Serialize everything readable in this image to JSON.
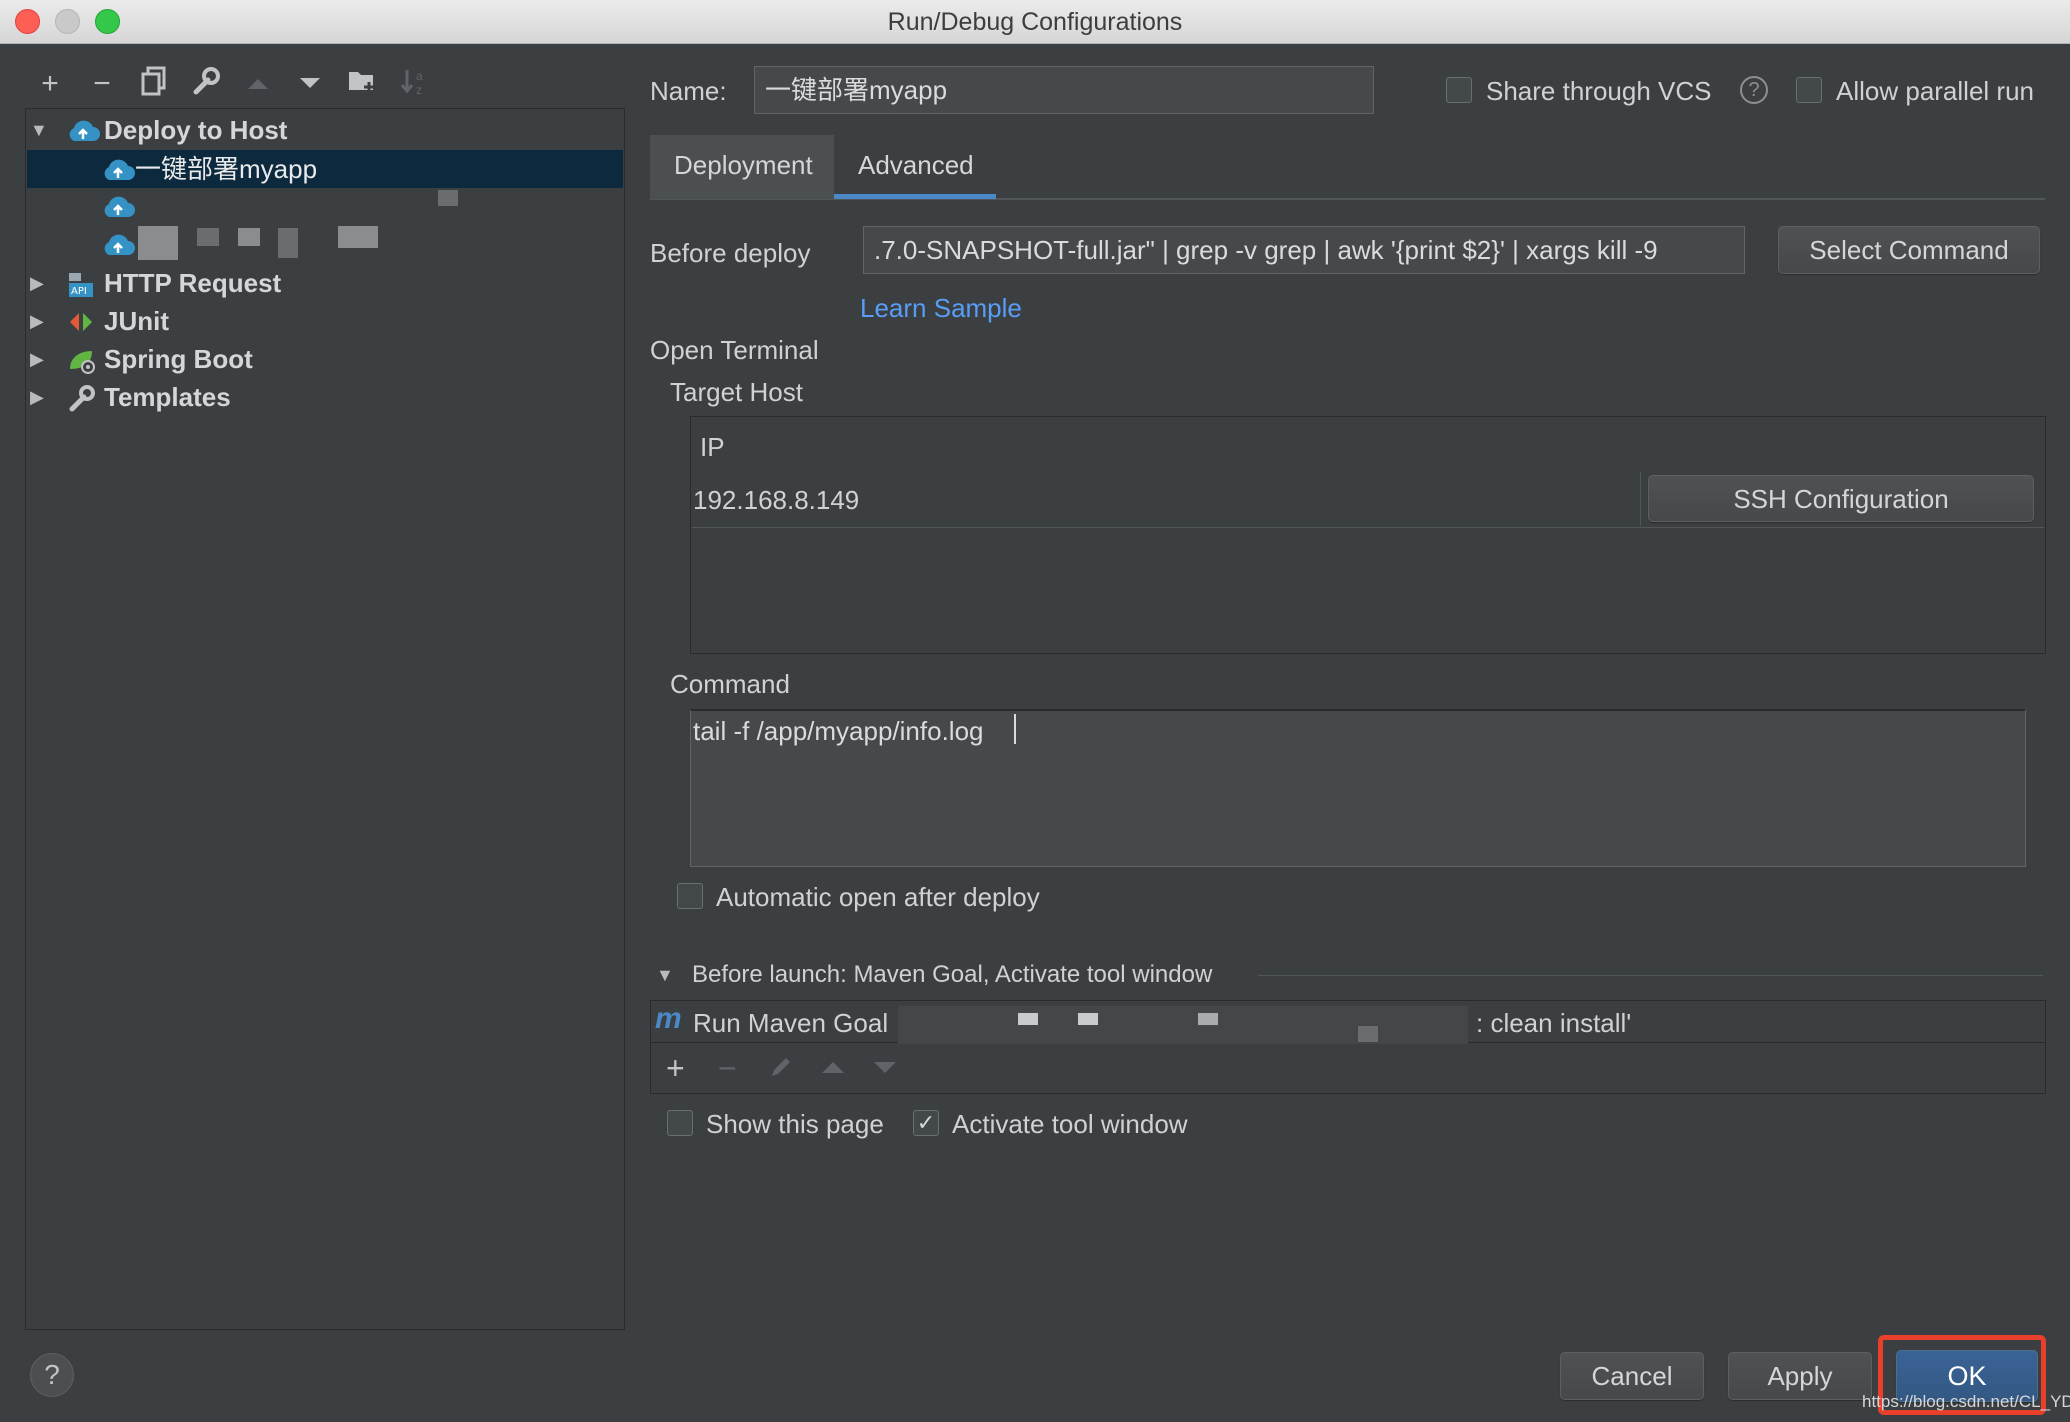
{
  "window": {
    "title": "Run/Debug Configurations"
  },
  "toolbar": {
    "icons": [
      "add-icon",
      "remove-icon",
      "copy-icon",
      "wrench-icon",
      "arrow-up-icon",
      "arrow-down-icon",
      "folder-icon",
      "sort-icon"
    ]
  },
  "tree": {
    "deploy_group": "Deploy to Host",
    "deploy_selected": "一键部署myapp",
    "http_request": "HTTP Request",
    "junit": "JUnit",
    "spring_boot": "Spring Boot",
    "templates": "Templates"
  },
  "form": {
    "name_label": "Name:",
    "name_value": "一键部署myapp",
    "share_vcs": "Share through VCS",
    "allow_parallel": "Allow parallel run",
    "tabs": [
      "Deployment",
      "Advanced"
    ],
    "active_tab": "Advanced",
    "before_deploy_label": "Before deploy",
    "before_deploy_value": ".7.0-SNAPSHOT-full.jar\" | grep -v grep | awk '{print $2}' | xargs kill -9",
    "select_command": "Select Command",
    "learn_sample": "Learn Sample",
    "open_terminal": "Open Terminal",
    "target_host": "Target Host",
    "ip_header": "IP",
    "ip_value": "192.168.8.149",
    "ssh_config": "SSH Configuration",
    "command_label": "Command",
    "command_value": "tail -f /app/myapp/info.log",
    "auto_open": "Automatic open after deploy"
  },
  "before_launch": {
    "header": "Before launch: Maven Goal, Activate tool window",
    "task_label": "Run Maven Goal",
    "task_suffix": ": clean install'",
    "show_page": "Show this page",
    "activate_tool": "Activate tool window",
    "activate_checked": "✓"
  },
  "footer": {
    "help": "?",
    "cancel": "Cancel",
    "apply": "Apply",
    "ok": "OK",
    "watermark": "https://blog.csdn.net/CL_YD"
  },
  "colors": {
    "background": "#3c3f41",
    "selection": "#0d293e",
    "link": "#589df6",
    "primary_button": "#365880",
    "highlight_box": "#e8402a"
  }
}
